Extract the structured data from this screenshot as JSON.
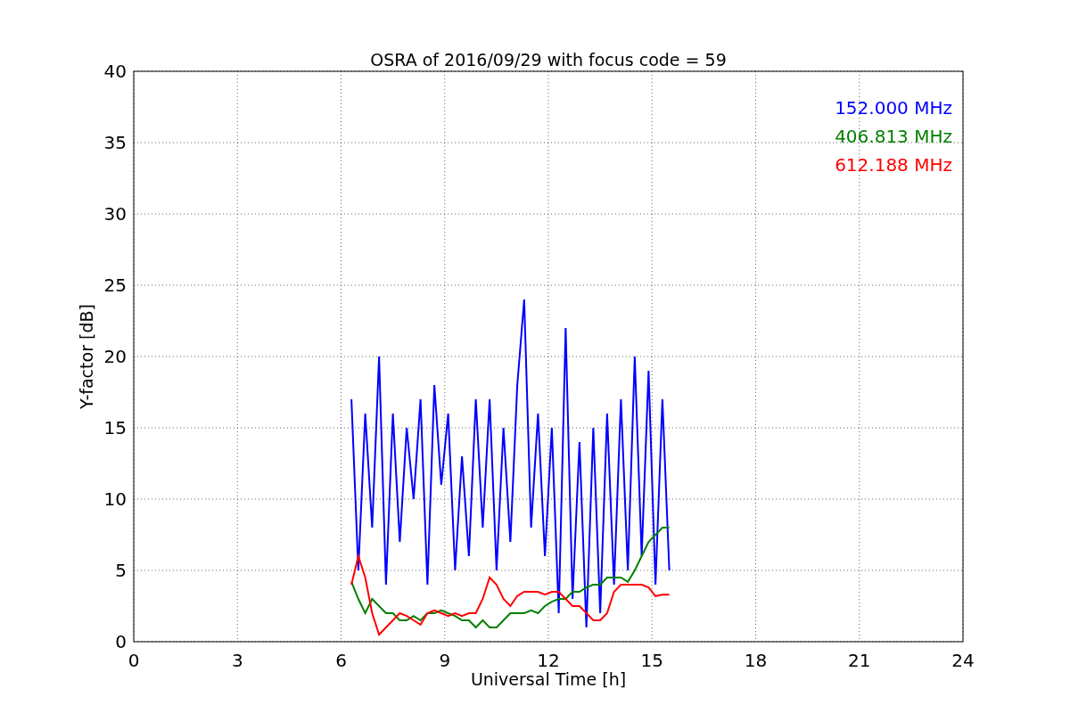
{
  "figure": {
    "chart_data": {
      "type": "line",
      "title": "OSRA of 2016/09/29 with focus code = 59",
      "xlabel": "Universal Time [h]",
      "ylabel": "Y-factor [dB]",
      "x": [
        6.3,
        6.5,
        6.7,
        6.9,
        7.1,
        7.3,
        7.5,
        7.7,
        7.9,
        8.1,
        8.3,
        8.5,
        8.7,
        8.9,
        9.1,
        9.3,
        9.5,
        9.7,
        9.9,
        10.1,
        10.3,
        10.5,
        10.7,
        10.9,
        11.1,
        11.3,
        11.5,
        11.7,
        11.9,
        12.1,
        12.3,
        12.5,
        12.7,
        12.9,
        13.1,
        13.3,
        13.5,
        13.7,
        13.9,
        14.1,
        14.3,
        14.5,
        14.7,
        14.9,
        15.1,
        15.3,
        15.5
      ],
      "series": [
        {
          "name": "152.000 MHz",
          "color": "#0000ff",
          "values": [
            17,
            5,
            16,
            8,
            20,
            4,
            16,
            7,
            15,
            10,
            17,
            4,
            18,
            11,
            16,
            5,
            13,
            6,
            17,
            8,
            17,
            5,
            15,
            7,
            18,
            24,
            8,
            16,
            6,
            15,
            2,
            22,
            3,
            14,
            1,
            15,
            2,
            16,
            4,
            17,
            5,
            20,
            6,
            19,
            4,
            17,
            5
          ]
        },
        {
          "name": "406.813 MHz",
          "color": "#008000",
          "values": [
            4.2,
            3,
            2,
            3,
            2.5,
            2,
            2,
            1.5,
            1.5,
            1.8,
            1.5,
            2,
            2,
            2.2,
            2,
            1.8,
            1.5,
            1.5,
            1,
            1.5,
            1,
            1,
            1.5,
            2,
            2,
            2,
            2.2,
            2,
            2.5,
            2.8,
            3,
            3,
            3.5,
            3.5,
            3.8,
            4,
            4,
            4.5,
            4.5,
            4.5,
            4.2,
            5,
            6,
            7,
            7.5,
            8,
            8
          ]
        },
        {
          "name": "612.188 MHz",
          "color": "#ff0000",
          "values": [
            4,
            6,
            4.5,
            2,
            0.5,
            1,
            1.5,
            2,
            1.8,
            1.5,
            1.2,
            2,
            2.2,
            2,
            1.8,
            2,
            1.8,
            2,
            2,
            3,
            4.5,
            4,
            3,
            2.5,
            3.2,
            3.5,
            3.5,
            3.5,
            3.3,
            3.5,
            3.5,
            3,
            2.5,
            2.5,
            2,
            1.5,
            1.5,
            2,
            3.5,
            4,
            4,
            4,
            4,
            3.8,
            3.2,
            3.3,
            3.3
          ]
        }
      ],
      "grid": true,
      "xlim": [
        0,
        24
      ],
      "ylim": [
        0,
        40
      ],
      "xticks": [
        0,
        3,
        6,
        9,
        12,
        15,
        18,
        21,
        24
      ],
      "yticks": [
        0,
        5,
        10,
        15,
        20,
        25,
        30,
        35,
        40
      ]
    }
  }
}
